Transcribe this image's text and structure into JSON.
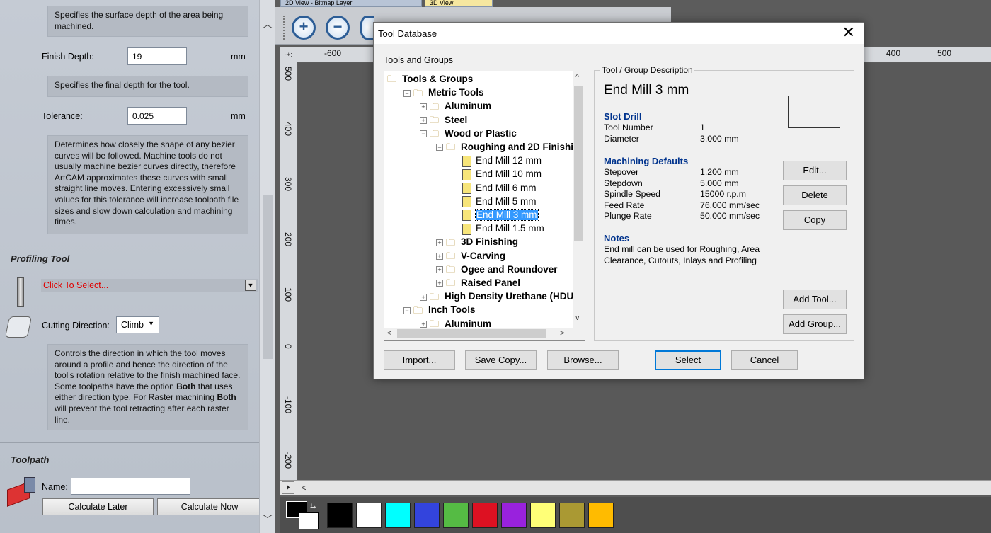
{
  "left_panel": {
    "desc_surface": "Specifies the surface depth of the area being machined.",
    "finish_depth_label": "Finish Depth:",
    "finish_depth_value": "19",
    "finish_depth_unit": "mm",
    "desc_finish": "Specifies the final depth for the tool.",
    "tolerance_label": "Tolerance:",
    "tolerance_value": "0.025",
    "tolerance_unit": "mm",
    "desc_tolerance": "Determines how closely the shape of any bezier curves will be followed. Machine tools do not usually machine bezier curves directly, therefore ArtCAM approximates these curves with small straight line moves. Entering excessively small values for this tolerance will increase toolpath file sizes and slow down calculation and machining times.",
    "profiling_title": "Profiling Tool",
    "click_to_select": "Click To Select...",
    "cutting_direction_label": "Cutting Direction:",
    "cutting_direction_value": "Climb",
    "desc_direction_1": "Controls the direction in which the tool moves around a profile and hence the direction of the tool's rotation relative to the finish machined face. Some toolpaths have the option ",
    "desc_direction_both1": "Both",
    "desc_direction_2": " that uses either direction type. For Raster machining ",
    "desc_direction_both2": "Both",
    "desc_direction_3": " will prevent the tool retracting after each raster line.",
    "toolpath_title": "Toolpath",
    "name_label": "Name:",
    "name_value": "",
    "calc_later": "Calculate Later",
    "calc_now": "Calculate Now"
  },
  "view": {
    "tabs": [
      "2D View - Bitmap Layer",
      "3D View"
    ],
    "ruler_top": [
      "-600",
      "400",
      "500"
    ],
    "ruler_left": [
      "500",
      "400",
      "300",
      "200",
      "100",
      "0",
      "-100",
      "-200"
    ]
  },
  "palette": {
    "colors": [
      "#000000",
      "#ffffff",
      "#00ffff",
      "#3344dd",
      "#55bb44",
      "#dd1122",
      "#9922dd",
      "#ffff77",
      "#aa9933",
      "#ffbb00"
    ]
  },
  "dialog": {
    "title": "Tool Database",
    "tools_groups_label": "Tools and Groups",
    "tree": [
      {
        "label": "Tools & Groups",
        "level": 0,
        "type": "folder",
        "exp": ""
      },
      {
        "label": "Metric Tools",
        "level": 1,
        "type": "folder",
        "exp": "−"
      },
      {
        "label": "Aluminum",
        "level": 2,
        "type": "folder",
        "exp": "+"
      },
      {
        "label": "Steel",
        "level": 2,
        "type": "folder",
        "exp": "+"
      },
      {
        "label": "Wood or Plastic",
        "level": 2,
        "type": "folder",
        "exp": "−"
      },
      {
        "label": "Roughing and 2D Finishi",
        "level": 3,
        "type": "folder",
        "exp": "−"
      },
      {
        "label": "End Mill 12 mm",
        "level": 4,
        "type": "tool",
        "exp": ""
      },
      {
        "label": "End Mill 10 mm",
        "level": 4,
        "type": "tool",
        "exp": ""
      },
      {
        "label": "End Mill 6 mm",
        "level": 4,
        "type": "tool",
        "exp": ""
      },
      {
        "label": "End Mill 5 mm",
        "level": 4,
        "type": "tool",
        "exp": ""
      },
      {
        "label": "End Mill 3 mm",
        "level": 4,
        "type": "tool",
        "exp": "",
        "selected": true
      },
      {
        "label": "End Mill 1.5 mm",
        "level": 4,
        "type": "tool",
        "exp": ""
      },
      {
        "label": "3D Finishing",
        "level": 3,
        "type": "folder",
        "exp": "+"
      },
      {
        "label": "V-Carving",
        "level": 3,
        "type": "folder",
        "exp": "+"
      },
      {
        "label": "Ogee and Roundover",
        "level": 3,
        "type": "folder",
        "exp": "+"
      },
      {
        "label": "Raised Panel",
        "level": 3,
        "type": "folder",
        "exp": "+"
      },
      {
        "label": "High Density Urethane (HDU",
        "level": 2,
        "type": "folder",
        "exp": "+"
      },
      {
        "label": "Inch Tools",
        "level": 1,
        "type": "folder",
        "exp": "−"
      },
      {
        "label": "Aluminum",
        "level": 2,
        "type": "folder",
        "exp": "+"
      }
    ],
    "description": {
      "group_label": "Tool / Group Description",
      "tool_name": "End Mill 3 mm",
      "tool_type": "Slot Drill",
      "tool_number_label": "Tool Number",
      "tool_number": "1",
      "diameter_label": "Diameter",
      "diameter": "3.000 mm",
      "machining_defaults": "Machining Defaults",
      "stepover_label": "Stepover",
      "stepover": "1.200 mm",
      "stepdown_label": "Stepdown",
      "stepdown": "5.000 mm",
      "spindle_label": "Spindle Speed",
      "spindle": "15000 r.p.m",
      "feed_label": "Feed Rate",
      "feed": "76.000 mm/sec",
      "plunge_label": "Plunge Rate",
      "plunge": "50.000 mm/sec",
      "notes_label": "Notes",
      "notes": "End mill can be used for Roughing, Area Clearance, Cutouts, Inlays and Profiling"
    },
    "buttons": {
      "edit": "Edit...",
      "delete": "Delete",
      "copy": "Copy",
      "add_tool": "Add Tool...",
      "add_group": "Add Group...",
      "import": "Import...",
      "save_copy": "Save Copy...",
      "browse": "Browse...",
      "select": "Select",
      "cancel": "Cancel"
    }
  }
}
